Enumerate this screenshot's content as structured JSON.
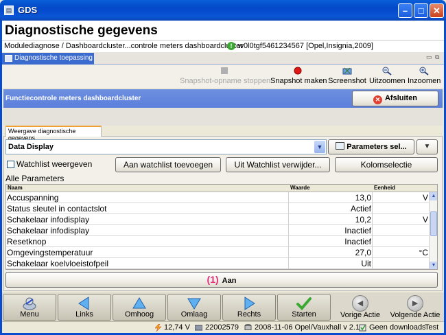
{
  "window": {
    "title": "GDS"
  },
  "header": {
    "page_title": "Diagnostische gegevens",
    "breadcrumb": "Modulediagnose / Dashboardcluster...controle meters dashboardcluster",
    "vin": "w0l0tgf5461234567 [Opel,Insignia,2009]"
  },
  "app_tab": {
    "label": "Diagnostische toepassing"
  },
  "toolbar": {
    "snapshot_stop": "Snapshot-opname stoppen",
    "snapshot_make": "Snapshot maken",
    "screenshot": "Screenshot",
    "zoom_out": "Uitzoomen",
    "zoom_in": "Inzoomen"
  },
  "function": {
    "title": "Functiecontrole meters dashboardcluster",
    "close_label": "Afsluiten"
  },
  "data_tab": {
    "label": "Weergave diagnostische gegevens"
  },
  "display_select": {
    "value": "Data Display"
  },
  "params_button": "Parameters sel...",
  "watchlist": {
    "checkbox_label": "Watchlist weergeven",
    "add_label": "Aan watchlist toevoegen",
    "remove_label": "Uit Watchlist verwijder...",
    "columns_label": "Kolomselectie"
  },
  "section_title": "Alle Parameters",
  "table": {
    "headers": {
      "name": "Naam",
      "value": "Waarde",
      "unit": "Eenheid"
    },
    "rows": [
      {
        "name": "Accuspanning",
        "value": "13,0",
        "unit": "V"
      },
      {
        "name": "Status sleutel in contactslot",
        "value": "Actief",
        "unit": ""
      },
      {
        "name": "Schakelaar infodisplay",
        "value": "10,2",
        "unit": "V"
      },
      {
        "name": "Schakelaar infodisplay",
        "value": "Inactief",
        "unit": ""
      },
      {
        "name": "Resetknop",
        "value": "Inactief",
        "unit": ""
      },
      {
        "name": "Omgevingstemperatuur",
        "value": "27,0",
        "unit": "°C"
      },
      {
        "name": "Schakelaar koelvloeistofpeil",
        "value": "Uit",
        "unit": ""
      }
    ]
  },
  "action_button": {
    "number": "(1)",
    "label": "Aan"
  },
  "nav": {
    "menu": "Menu",
    "left": "Links",
    "up": "Omhoog",
    "down": "Omlaag",
    "right": "Rechts",
    "start": "Starten",
    "prev": "Vorige Actie",
    "next": "Volgende Actie"
  },
  "status": {
    "voltage": "12,74 V",
    "id": "22002579",
    "version": "2008-11-06 Opel/Vauxhall v 2.1",
    "downloads": "Geen downloads",
    "mode": "Test"
  },
  "colors": {
    "titlebar": "#0a5fd8",
    "function_bar": "#5a7fdb",
    "accent_pink": "#e0307c",
    "start_green": "#3aa832"
  }
}
